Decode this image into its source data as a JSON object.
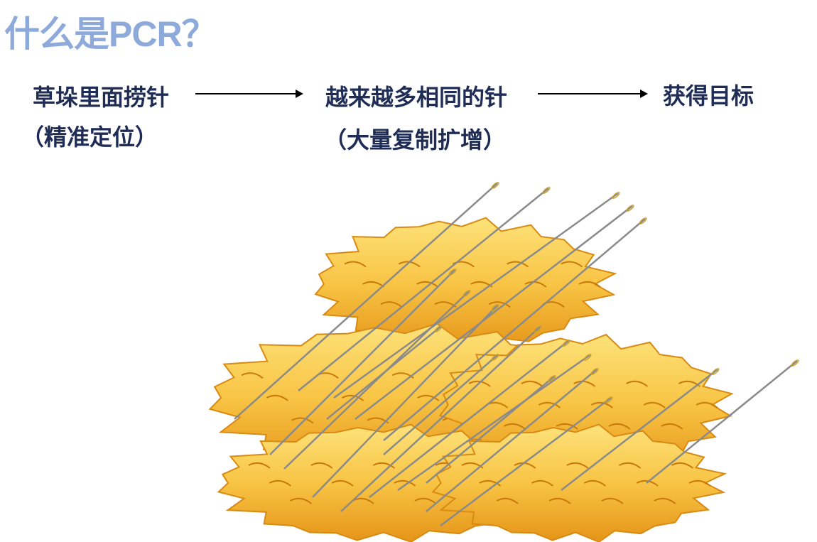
{
  "title": "什么是PCR？",
  "steps": [
    {
      "label": "草垛里面捞针",
      "note": "（精准定位）"
    },
    {
      "label": "越来越多相同的针",
      "note": "（大量复制扩增）"
    },
    {
      "label": "获得目标"
    }
  ],
  "colors": {
    "title": "#8eaadb",
    "text": "#1f2c56",
    "hay_light": "#fbd25a",
    "hay_dark": "#e79a1c"
  },
  "illustration": "haystack-with-needles"
}
